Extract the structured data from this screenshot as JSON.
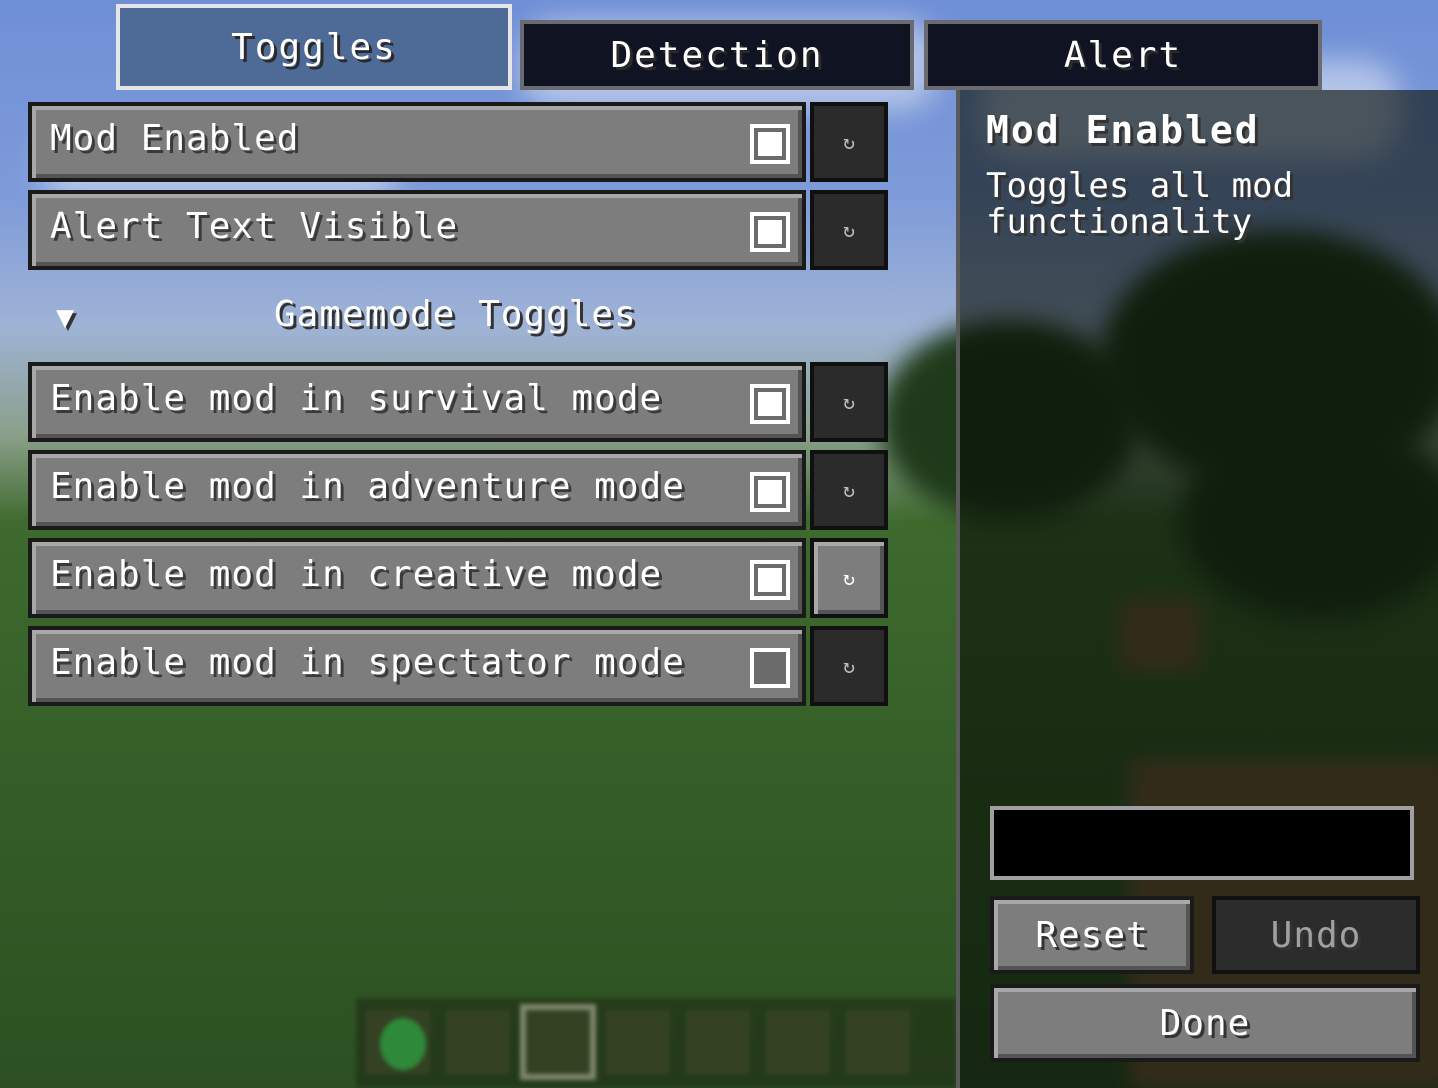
{
  "tabs": [
    {
      "label": "Toggles",
      "active": true
    },
    {
      "label": "Detection",
      "active": false
    },
    {
      "label": "Alert",
      "active": false
    }
  ],
  "toggles": {
    "rows": [
      {
        "label": "Mod Enabled",
        "checked": true
      },
      {
        "label": "Alert Text Visible",
        "checked": true
      }
    ],
    "section": {
      "arrow": "▼",
      "title": "Gamemode Toggles"
    },
    "gamemode_rows": [
      {
        "label": "Enable mod in survival mode",
        "checked": true
      },
      {
        "label": "Enable mod in adventure mode",
        "checked": true
      },
      {
        "label": "Enable mod in creative mode",
        "checked": true
      },
      {
        "label": "Enable mod in spectator mode",
        "checked": false
      }
    ],
    "reset_icon": "↻"
  },
  "info": {
    "title": "Mod Enabled",
    "description": "Toggles all mod functionality",
    "value": "",
    "reset_label": "Reset",
    "undo_label": "Undo",
    "done_label": "Done"
  }
}
